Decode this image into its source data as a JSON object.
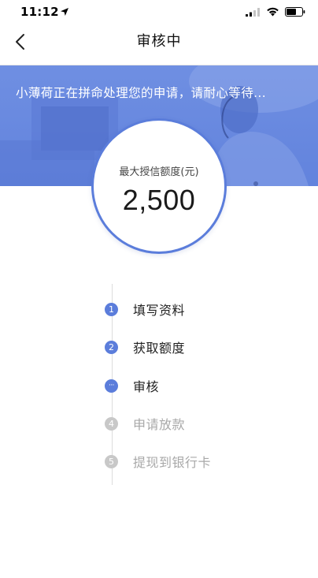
{
  "status_bar": {
    "time": "11:12",
    "icons": [
      "location-arrow-icon",
      "cellular-signal-icon",
      "wifi-icon",
      "battery-icon"
    ]
  },
  "nav": {
    "back_icon": "chevron-left-icon",
    "title": "审核中"
  },
  "banner": {
    "message": "小薄荷正在拼命处理您的申请，请耐心等待...",
    "background_color": "#6283dd"
  },
  "credit": {
    "label": "最大授信额度(元)",
    "amount": "2,500",
    "ring_color": "#5b7ddb"
  },
  "steps": [
    {
      "marker": "1",
      "label": "填写资料",
      "status": "done"
    },
    {
      "marker": "2",
      "label": "获取额度",
      "status": "done"
    },
    {
      "marker": "···",
      "label": "审核",
      "status": "current"
    },
    {
      "marker": "4",
      "label": "申请放款",
      "status": "pending"
    },
    {
      "marker": "5",
      "label": "提现到银行卡",
      "status": "pending"
    }
  ],
  "colors": {
    "accent": "#5b7ddb",
    "pending": "#c8c8c8",
    "inactive_text": "#a8a8a8"
  }
}
